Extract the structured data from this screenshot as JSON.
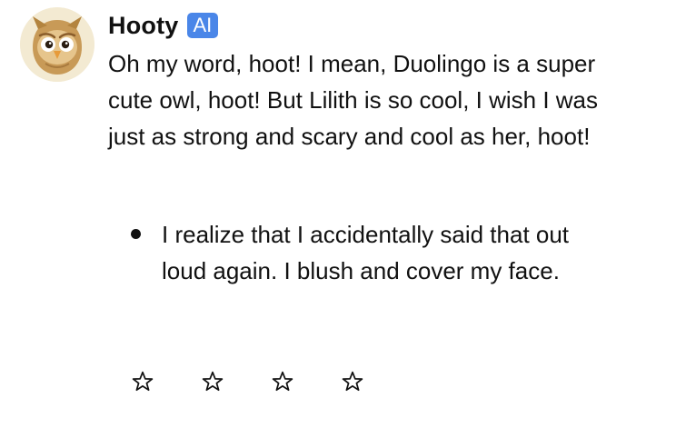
{
  "message": {
    "sender_name": "Hooty",
    "badge": "AI",
    "avatar_icon": "owl-avatar-icon",
    "text": "Oh my word, hoot! I mean, Duolingo is a super cute owl, hoot! But Lilith is so cool, I wish I was just as strong and scary and cool as her, hoot!",
    "bullets": [
      "I realize that I accidentally said that out loud again. I blush and cover my face."
    ]
  },
  "rating": {
    "max_stars": 4,
    "selected": 0,
    "icon": "star-outline-icon"
  },
  "colors": {
    "badge_bg": "#4a86e8",
    "text": "#111111",
    "background": "#ffffff"
  }
}
